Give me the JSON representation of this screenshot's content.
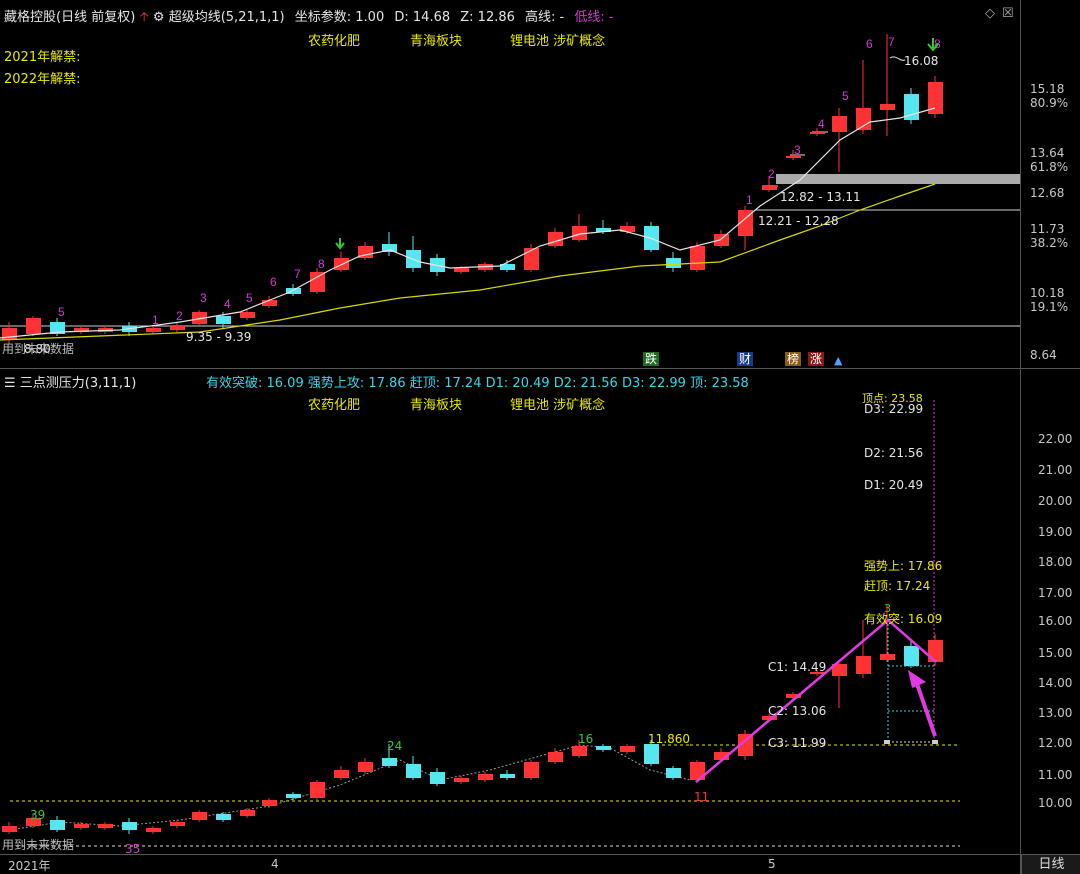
{
  "top_panel": {
    "stock_name": "藏格控股",
    "period_label": "(日线 前复权)",
    "indicator_name": "超级均线(5,21,1,1)",
    "coord_label": "坐标参数: 1.00",
    "d_label": "D: 14.68",
    "z_label": "Z: 12.86",
    "high_label": "高线: -",
    "low_label": "低线: -",
    "sectors": [
      "农药化肥",
      "青海板块",
      "锂电池 涉矿概念"
    ],
    "unlock_2021": "2021年解禁:",
    "unlock_2022": "2022年解禁:",
    "future_data": "用到未来数据",
    "price_axis": [
      "15.18",
      "80.9%",
      "13.64",
      "61.8%",
      "12.68",
      "11.73",
      "38.2%",
      "10.18",
      "19.1%",
      "8.64"
    ],
    "zone_upper": "12.82 - 13.11",
    "zone_lower": "12.21 - 12.28",
    "peak_label": "16.08",
    "low_point_label": "8.80",
    "bottom_zone": "9.35 - 9.39",
    "event_badges": [
      "跌",
      "财",
      "榜",
      "涨"
    ],
    "count_labels": [
      "5",
      "1",
      "2",
      "3",
      "4",
      "5",
      "6",
      "7",
      "8",
      "1",
      "2",
      "3",
      "4",
      "5",
      "6",
      "7",
      "8"
    ]
  },
  "bottom_panel": {
    "indicator_name": "三点测压力(3,11,1)",
    "breakout": "有效突破: 16.09",
    "strong_attack": "强势上攻: 17.86",
    "rush_top": "赶顶: 17.24",
    "d1": "D1: 20.49",
    "d2": "D2: 21.56",
    "d3": "D3: 22.99",
    "top": "顶: 23.58",
    "sectors": [
      "农药化肥",
      "青海板块",
      "锂电池 涉矿概念"
    ],
    "right_labels": {
      "top_pt": "顶点: 23.58",
      "d3": "D3: 22.99",
      "d2": "D2: 21.56",
      "d1": "D1: 20.49",
      "strong": "强势上: 17.86",
      "rush": "赶顶: 17.24",
      "breakout": "有效突: 16.09",
      "c1": "C1: 14.49",
      "c2": "C2: 13.06",
      "c3": "C3: 11.99"
    },
    "price_axis": [
      "22.00",
      "21.00",
      "20.00",
      "19.00",
      "18.00",
      "17.00",
      "16.00",
      "15.00",
      "14.00",
      "13.00",
      "12.00",
      "11.00",
      "10.00"
    ],
    "pt_labels": {
      "p39": "39",
      "p35": "35",
      "p24": "24",
      "p16": "16",
      "p11": "11",
      "p3": "3",
      "level": "11.860"
    },
    "future_data": "用到未来数据"
  },
  "time_axis": {
    "year": "2021年",
    "m4": "4",
    "m5": "5",
    "period_button": "日线"
  },
  "colors": {
    "up": "#ff3333",
    "down": "#55e6f0",
    "ma_white": "#e6e6e6",
    "ma_yellow": "#d8d800",
    "arrow": "#e23ae2"
  }
}
